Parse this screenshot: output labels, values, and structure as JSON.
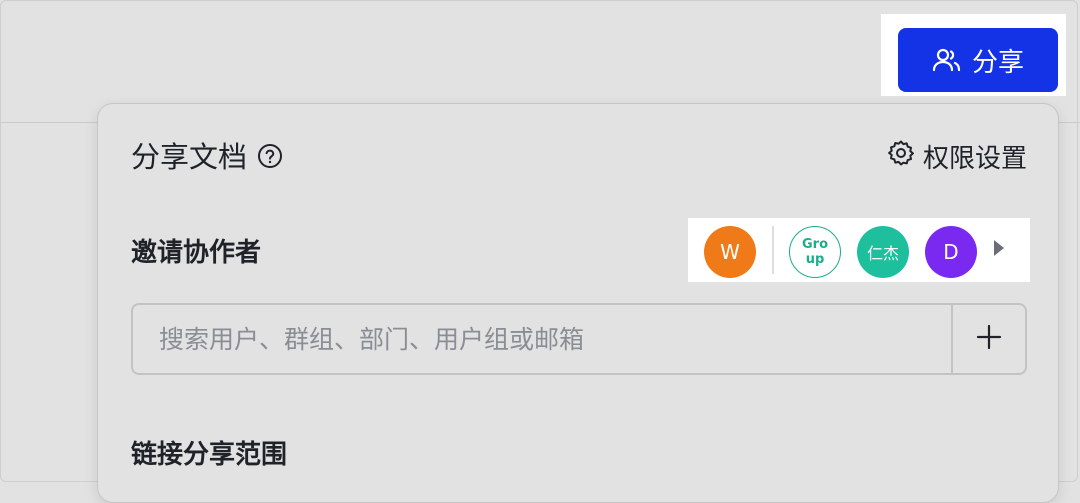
{
  "header": {
    "share_button": {
      "label": "分享",
      "icon": "users-icon",
      "color": "#1433e6"
    }
  },
  "share_panel": {
    "title": "分享文档",
    "help_icon": "question-circle-icon",
    "permission_settings": {
      "label": "权限设置",
      "icon": "gear-icon"
    },
    "invite": {
      "label": "邀请协作者",
      "avatars": [
        {
          "text": "W",
          "color": "#f07a17"
        },
        {
          "text": "Group",
          "color": "#1aae8a"
        },
        {
          "text": "仁杰",
          "color": "#1ebf9c"
        },
        {
          "text": "D",
          "color": "#7a29f0"
        }
      ],
      "more_icon": "caret-right-icon"
    },
    "search": {
      "placeholder": "搜索用户、群组、部门、用户组或邮箱",
      "value": "",
      "add_icon": "plus-icon"
    },
    "link_scope": {
      "label": "链接分享范围"
    }
  }
}
